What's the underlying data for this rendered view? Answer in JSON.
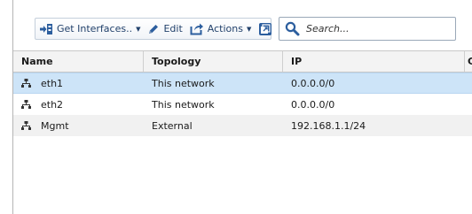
{
  "toolbar": {
    "get_interfaces_label": "Get Interfaces..",
    "edit_label": "Edit",
    "actions_label": "Actions"
  },
  "search": {
    "placeholder": "Search..."
  },
  "table": {
    "columns": [
      "Name",
      "Topology",
      "IP",
      "C"
    ],
    "rows": [
      {
        "name": "eth1",
        "topology": "This network",
        "ip": "0.0.0.0/0",
        "selected": true
      },
      {
        "name": "eth2",
        "topology": "This network",
        "ip": "0.0.0.0/0",
        "selected": false
      },
      {
        "name": "Mgmt",
        "topology": "External",
        "ip": "192.168.1.1/24",
        "selected": false
      }
    ]
  },
  "colors": {
    "selected_row": "#cde4f8",
    "alt_row": "#f1f1f1",
    "toolbar_text": "#22416b",
    "icon_blue": "#2c5e9e"
  },
  "icons": [
    "get-interfaces-icon",
    "edit-pencil-icon",
    "actions-icon",
    "popout-window-icon",
    "search-icon",
    "network-interface-icon"
  ]
}
